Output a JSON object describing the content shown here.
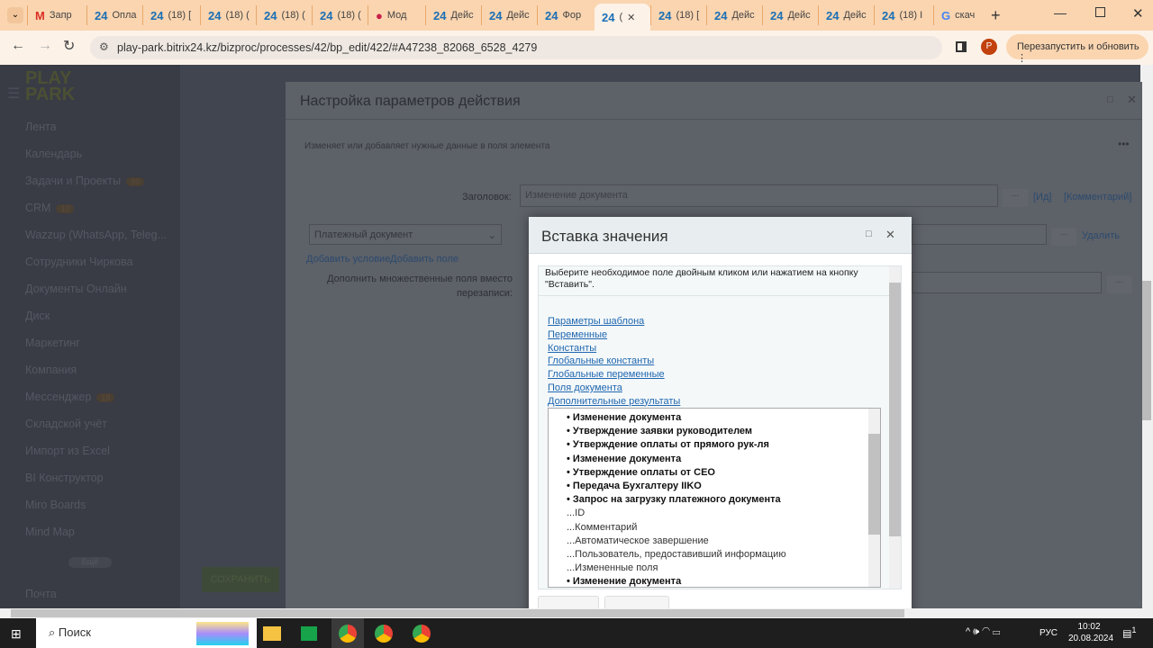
{
  "browser": {
    "tabs": [
      "Запр",
      "Опла",
      "(18) [",
      "(18) (",
      "(18) (",
      "(18) (",
      "Мод",
      "Дейс",
      "Дейс",
      "Фор",
      "(",
      "(18) [",
      "Дейс",
      "Дейс",
      "Дейс",
      "(18) I",
      "скач"
    ],
    "url": "play-park.bitrix24.kz/bizproc/processes/42/bp_edit/422/#A47238_82068_6528_4279",
    "profile_letter": "P",
    "restart_label": "Перезапустить и обновить"
  },
  "sidebar": {
    "logo": "PLAY PARK",
    "items": [
      "Лента",
      "Календарь",
      "Задачи и Проекты",
      "CRM",
      "Wazzup (WhatsApp, Teleg...",
      "Сотрудники Чиркова",
      "Документы Онлайн",
      "Диск",
      "Маркетинг",
      "Компания",
      "Мессенджер",
      "Складской учёт",
      "Импорт из Excel",
      "BI Конструктор",
      "Miro Boards",
      "Mind Map"
    ],
    "badges": {
      "tasks": "99",
      "crm": "10",
      "messenger": "18"
    },
    "more": "Ещё",
    "mail": "Почта",
    "save": "СОХРАНИТЬ"
  },
  "settings_dialog": {
    "title": "Настройка параметров действия",
    "desc": "Изменяет или добавляет нужные данные в поля элемента",
    "title_label": "Заголовок:",
    "title_value": "Изменение документа",
    "id_link": "[Ид]",
    "comment_link": "[Комментарий]",
    "field_select": "Платежный документ",
    "delete": "Удалить",
    "add_condition": "Добавить условие",
    "add_field": "Добавить поле",
    "multi_label": "Дополнить множественные поля вместо перезаписи:",
    "dots": "..."
  },
  "insert_dialog": {
    "title": "Вставка значения",
    "hint": "Выберите необходимое поле двойным кликом или нажатием на кнопку \"Вставить\".",
    "links": [
      "Параметры шаблона",
      "Переменные",
      "Константы",
      "Глобальные константы",
      "Глобальные переменные",
      "Поля документа",
      "Дополнительные результаты"
    ],
    "list": [
      {
        "t": "• Изменение документа",
        "b": true
      },
      {
        "t": "• Утверждение заявки руководителем",
        "b": true
      },
      {
        "t": "• Утверждение оплаты от прямого рук-ля",
        "b": true
      },
      {
        "t": "• Изменение документа",
        "b": true
      },
      {
        "t": "• Утверждение оплаты от CEO",
        "b": true
      },
      {
        "t": "• Передача Бухгалтеру IIKO",
        "b": true
      },
      {
        "t": "• Запрос на загрузку платежного документа",
        "b": true
      },
      {
        "t": "...ID",
        "b": false
      },
      {
        "t": "...Комментарий",
        "b": false
      },
      {
        "t": "...Автоматическое завершение",
        "b": false
      },
      {
        "t": "...Пользователь, предоставивший информацию",
        "b": false
      },
      {
        "t": "...Измененные поля",
        "b": false
      },
      {
        "t": "• Изменение документа",
        "b": true
      }
    ]
  },
  "taskbar": {
    "search": "Поиск",
    "lang": "РУС",
    "time": "10:02",
    "date": "20.08.2024",
    "notif": "1"
  }
}
